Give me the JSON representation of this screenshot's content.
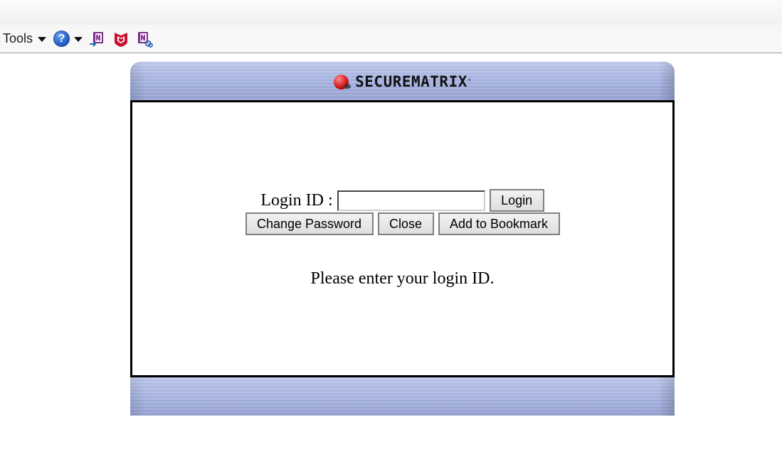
{
  "toolbar": {
    "tools_label": "Tools",
    "help_symbol": "?",
    "icons": [
      "onenote-send-icon",
      "mcafee-icon",
      "onenote-linked-notes-icon"
    ]
  },
  "panel": {
    "brand": "SECUREMATRIX",
    "brand_mark": "°",
    "login_label": "Login ID :",
    "login_value": "",
    "login_button": "Login",
    "change_password_button": "Change Password",
    "close_button": "Close",
    "bookmark_button": "Add to Bookmark",
    "message": "Please enter your login ID."
  },
  "colors": {
    "header_stripe_dark": "#8f9fd6",
    "header_stripe_light": "#c9d2f0",
    "help_blue": "#1d56c0",
    "onenote_purple": "#7b2d8e",
    "mcafee_red": "#c8102e"
  }
}
